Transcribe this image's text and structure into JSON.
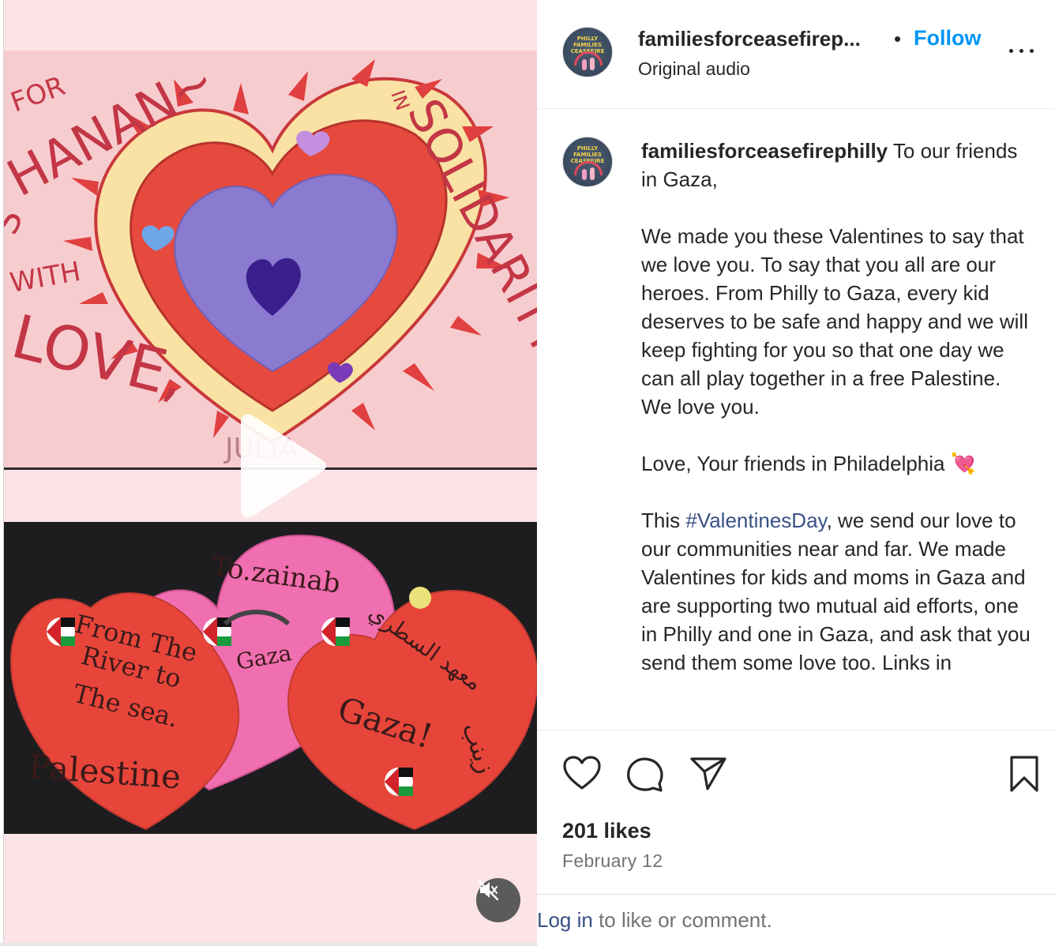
{
  "header": {
    "username": "familiesforceasefirep...",
    "separator": "•",
    "follow_label": "Follow",
    "audio_label": "Original audio"
  },
  "avatar": {
    "text_line1": "PHILLY",
    "text_line2": "FAMILIES",
    "text_line3": "CEASEFIRE"
  },
  "caption": {
    "username": "familiesforceasefirephilly",
    "intro": " To our friends in Gaza,",
    "para1": "We made you these Valentines to say that we love you. To say that you all are our heroes. From Philly to Gaza, every kid deserves to be safe and happy and we will keep fighting for you so that one day we can all play together in a free Palestine. We love you.",
    "para2": "Love, Your friends in Philadelphia 💘",
    "para3_a": "This ",
    "hashtag": "#ValentinesDay",
    "para3_b": ", we send our love to our communities near and far. We made Valentines for kids and moms in Gaza and are supporting two mutual aid efforts, one in Philly and one in Gaza, and ask that you send them some love too. Links in"
  },
  "media": {
    "top_card": {
      "for": "FOR",
      "name": "HANAN~",
      "in": "IN",
      "solidarity": "SOLIDARITY",
      "with": "WITH",
      "love": "LOVE,",
      "signature": "JULIA",
      "s": "S"
    },
    "bottom_card": {
      "to": "To.zainab",
      "river1": "From The",
      "river2": "River to",
      "river3": "The sea.",
      "palestine": "Palestine",
      "gaza_small": "Gaza",
      "gaza_big": "Gaza!",
      "arabic1": "معهد السطري",
      "arabic2": "زينب"
    },
    "colors": {
      "pink_paper": "#f7cccf",
      "red_heart": "#e2453e",
      "purple": "#8a7bd0",
      "magenta": "#f06fb0"
    }
  },
  "actions": {
    "like_icon": "heart-icon",
    "comment_icon": "comment-icon",
    "share_icon": "share-icon",
    "save_icon": "bookmark-icon"
  },
  "stats": {
    "likes": "201 likes",
    "date": "February 12"
  },
  "login": {
    "link": "Log in",
    "rest": " to like or comment."
  }
}
